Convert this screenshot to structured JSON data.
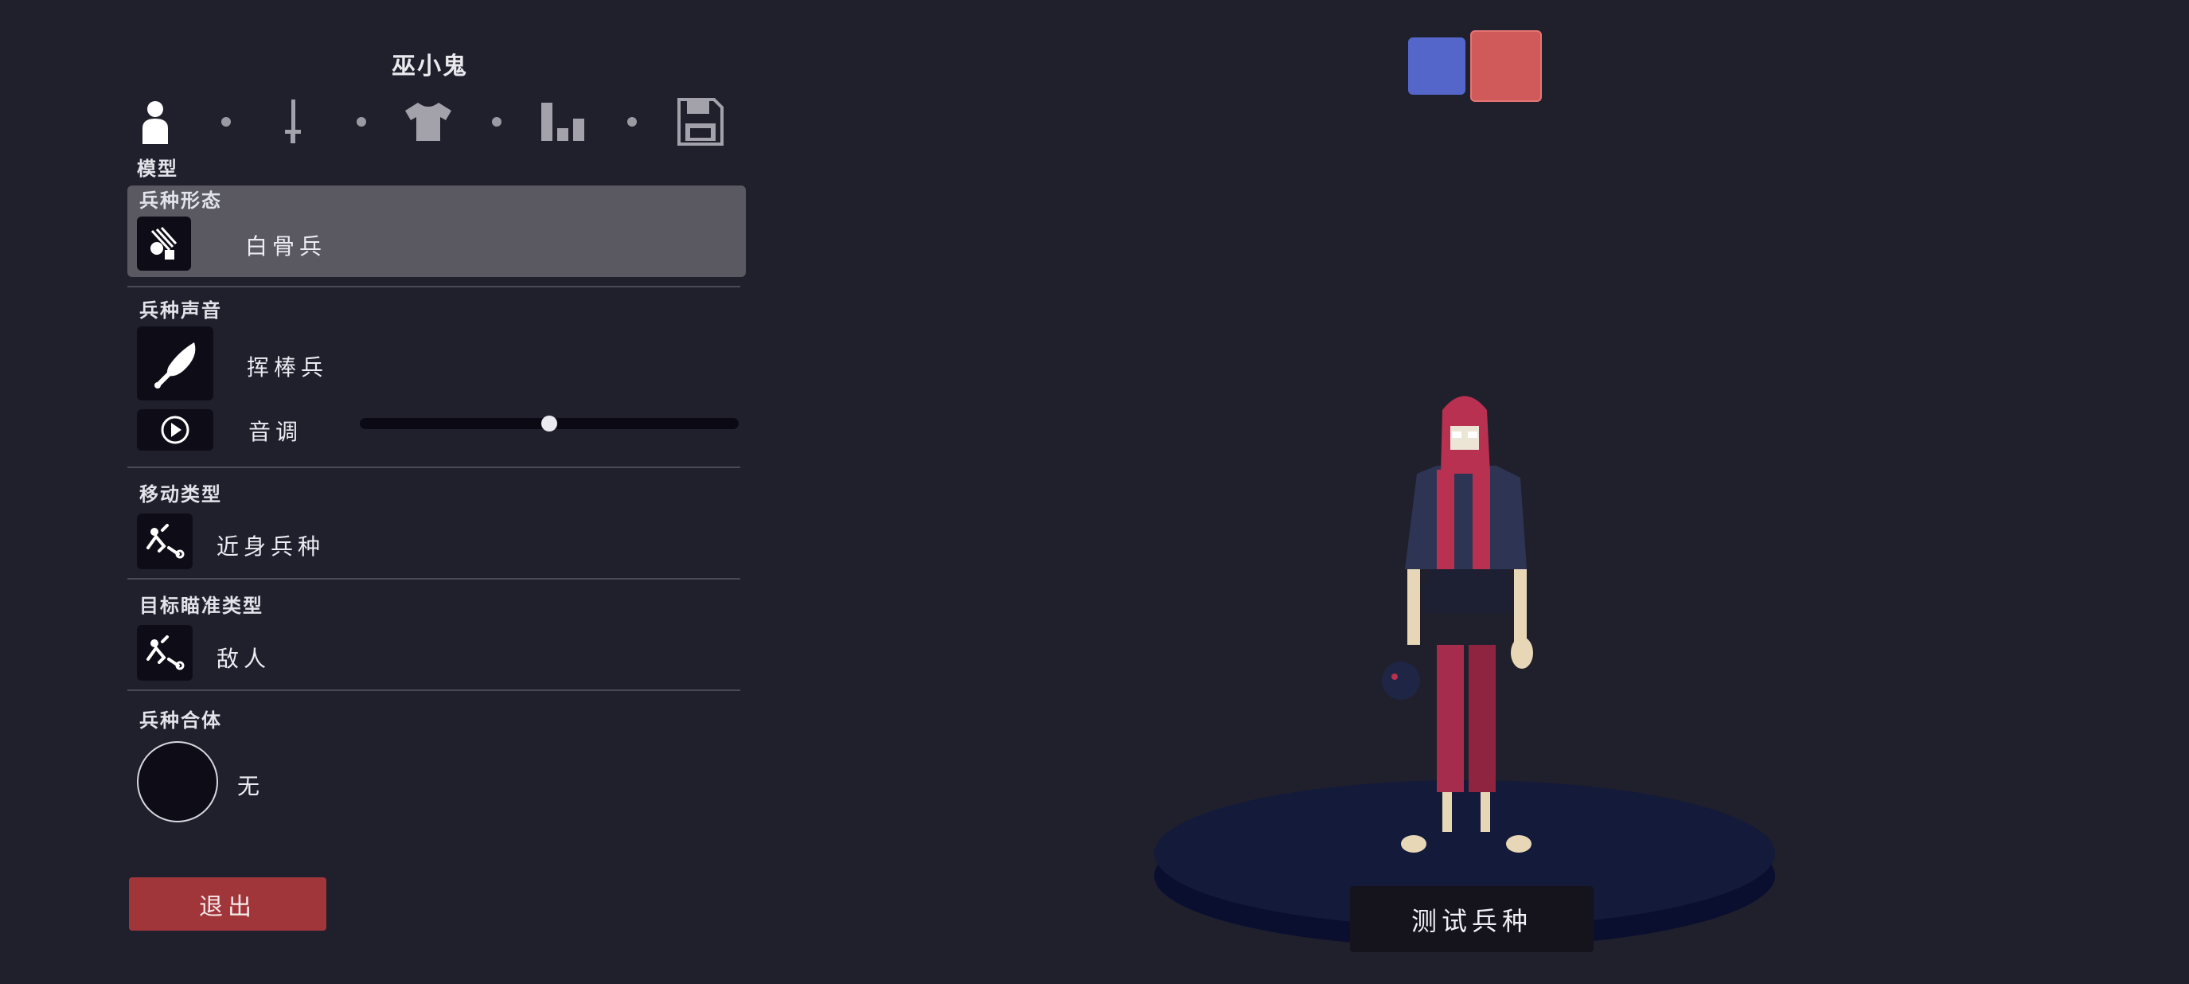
{
  "unit_name": "巫小鬼",
  "tabs": [
    {
      "icon": "person-icon"
    },
    {
      "icon": "sword-icon"
    },
    {
      "icon": "shirt-icon"
    },
    {
      "icon": "stats-icon"
    },
    {
      "icon": "save-icon"
    }
  ],
  "active_tab_label": "模型",
  "sections": {
    "form": {
      "label": "兵种形态",
      "value": "白骨兵",
      "icon": "skeleton-unit-icon"
    },
    "voice": {
      "label": "兵种声音",
      "value": "挥棒兵",
      "icon": "club-icon",
      "pitch_label": "音调",
      "pitch_value": 0.5,
      "play_icon": "play-icon"
    },
    "movement": {
      "label": "移动类型",
      "value": "近身兵种",
      "icon": "melee-icon"
    },
    "targeting": {
      "label": "目标瞄准类型",
      "value": "敌人",
      "icon": "target-icon"
    },
    "merge": {
      "label": "兵种合体",
      "value": "无"
    }
  },
  "exit_label": "退出",
  "test_label": "测试兵种",
  "team_colors": {
    "blue": "#5466c9",
    "red": "#cf5a59",
    "selected": "red"
  }
}
